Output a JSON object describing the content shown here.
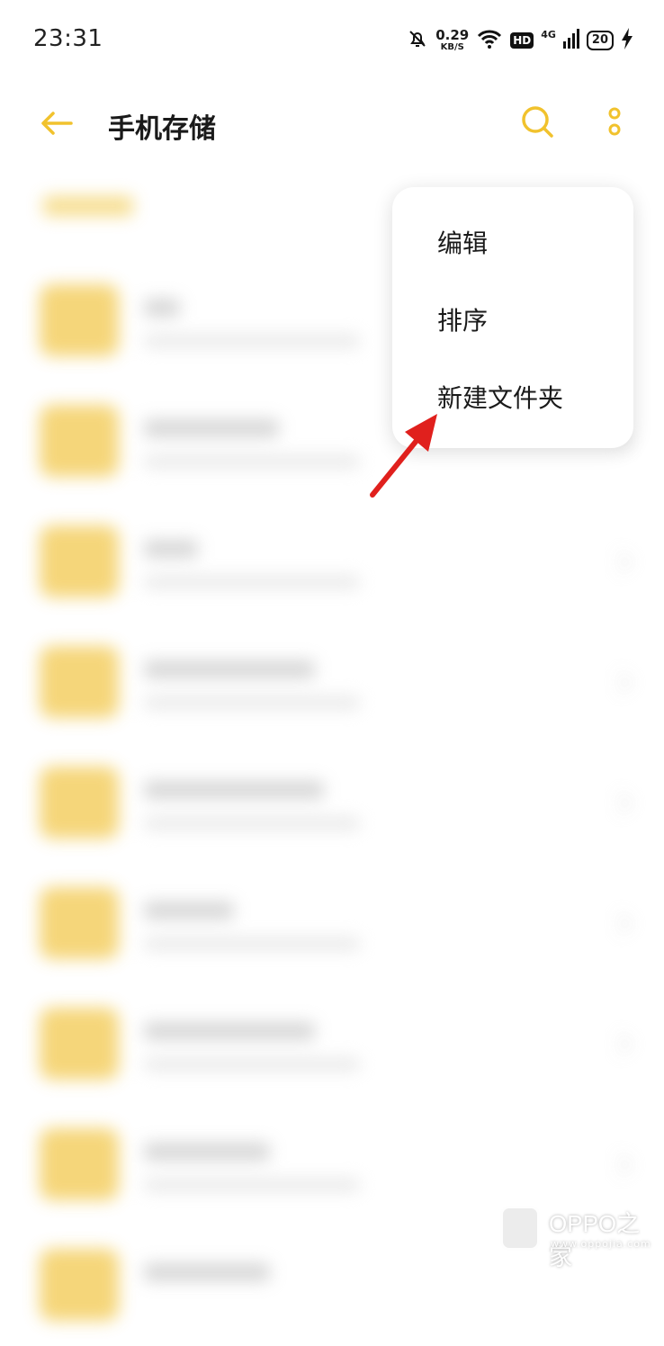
{
  "status_bar": {
    "time": "23:31",
    "net_speed_value": "0.29",
    "net_speed_unit": "KB/S",
    "hd": "HD",
    "network": "4G",
    "battery": "20",
    "icons": [
      "bell-off-icon",
      "wifi-icon",
      "signal-icon",
      "charging-icon"
    ]
  },
  "app_bar": {
    "title": "手机存储",
    "accent_color": "#f1c22d",
    "icons": [
      "back-arrow-icon",
      "search-icon",
      "more-vertical-icon"
    ]
  },
  "menu": {
    "items": [
      {
        "label": "编辑"
      },
      {
        "label": "排序"
      },
      {
        "label": "新建文件夹"
      }
    ]
  },
  "annotation": {
    "arrow_color": "#e0201d"
  },
  "watermark": {
    "text": "OPPO之家",
    "url": "www.oppojia.com"
  }
}
